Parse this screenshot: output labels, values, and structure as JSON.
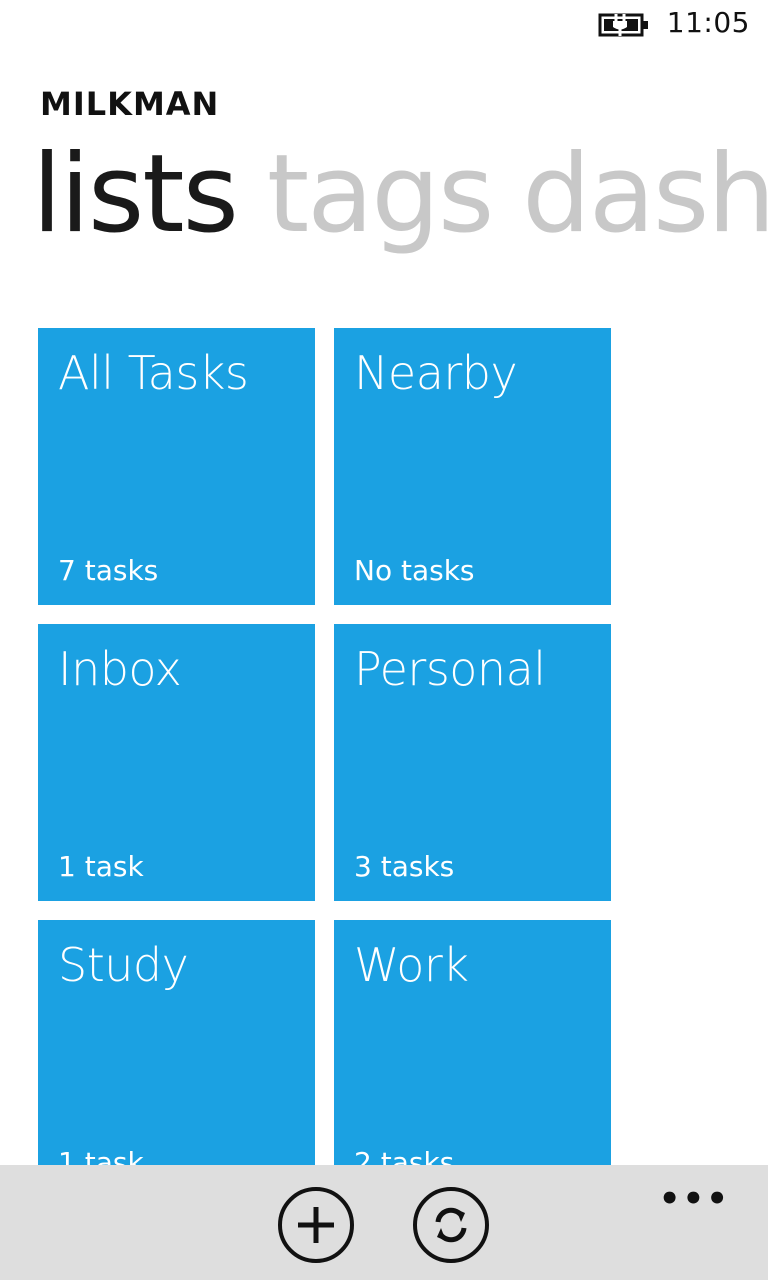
{
  "status_bar": {
    "time": "11:05",
    "battery_icon": "battery-charging-icon"
  },
  "app": {
    "title": "MILKMAN"
  },
  "pivot": {
    "items": [
      {
        "label": "lists",
        "active": true
      },
      {
        "label": "tags",
        "active": false
      },
      {
        "label": "dashb",
        "active": false
      }
    ]
  },
  "tiles": [
    {
      "title": "All Tasks",
      "count": "7 tasks"
    },
    {
      "title": "Nearby",
      "count": "No tasks"
    },
    {
      "title": "Inbox",
      "count": "1 task"
    },
    {
      "title": "Personal",
      "count": "3 tasks"
    },
    {
      "title": "Study",
      "count": "1 task"
    },
    {
      "title": "Work",
      "count": "2 tasks"
    }
  ],
  "app_bar": {
    "buttons": [
      {
        "icon": "add-icon"
      },
      {
        "icon": "sync-icon"
      }
    ],
    "more": "•••"
  },
  "colors": {
    "tile": "#1ba1e2",
    "app_bar": "#dedede",
    "pivot_inactive": "#c8c8c8"
  }
}
